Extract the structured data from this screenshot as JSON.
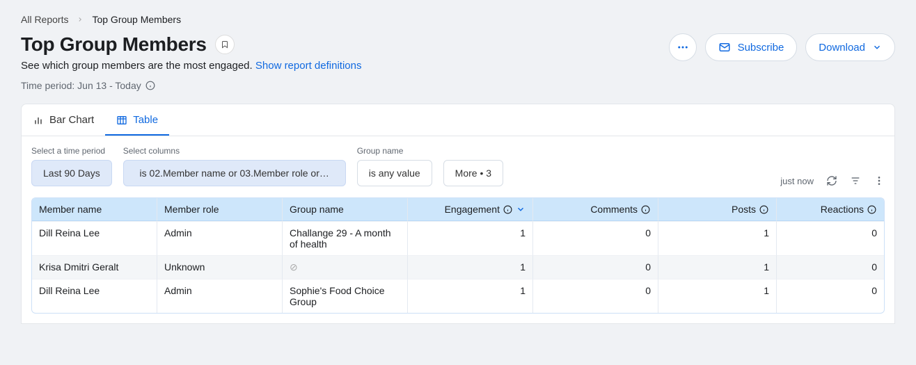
{
  "breadcrumbs": {
    "root": "All Reports",
    "current": "Top Group Members"
  },
  "title": "Top Group Members",
  "subtitle_text": "See which group members are the most engaged.",
  "definitions_link": "Show report definitions",
  "time_period_label": "Time period: Jun 13 - Today",
  "actions": {
    "subscribe": "Subscribe",
    "download": "Download"
  },
  "tabs": {
    "bar": "Bar Chart",
    "table": "Table"
  },
  "controls": {
    "time_label": "Select a time period",
    "time_value": "Last 90 Days",
    "columns_label": "Select columns",
    "columns_value": "is 02.Member name or 03.Member role or…",
    "groupname_label": "Group name",
    "groupname_value": "is any value",
    "more_value": "More • 3",
    "timestamp": "just now"
  },
  "columns": {
    "member_name": "Member name",
    "member_role": "Member role",
    "group_name": "Group name",
    "engagement": "Engagement",
    "comments": "Comments",
    "posts": "Posts",
    "reactions": "Reactions"
  },
  "rows": [
    {
      "member_name": "Dill Reina Lee",
      "member_role": "Admin",
      "group_name": "Challange 29 - A month of health",
      "engagement": "1",
      "comments": "0",
      "posts": "1",
      "reactions": "0",
      "null_group": false
    },
    {
      "member_name": "Krisa Dmitri Geralt",
      "member_role": "Unknown",
      "group_name": "",
      "engagement": "1",
      "comments": "0",
      "posts": "1",
      "reactions": "0",
      "null_group": true
    },
    {
      "member_name": "Dill Reina Lee",
      "member_role": "Admin",
      "group_name": "Sophie's Food Choice Group",
      "engagement": "1",
      "comments": "0",
      "posts": "1",
      "reactions": "0",
      "null_group": false
    }
  ]
}
